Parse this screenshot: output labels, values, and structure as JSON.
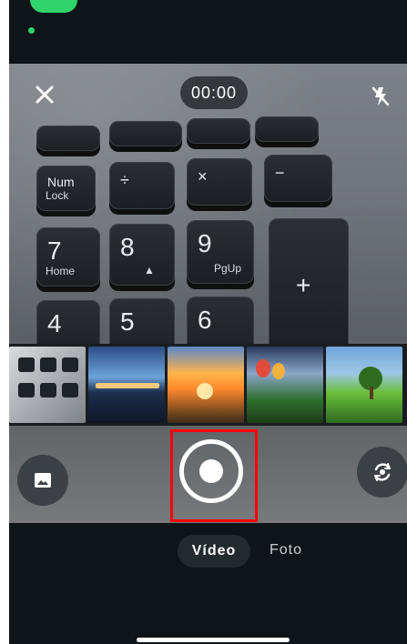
{
  "status": {
    "accent": "#2fd46a"
  },
  "camera": {
    "timer": "00:00",
    "close_icon": "close-icon",
    "flash_icon": "flash-off-icon",
    "gallery_icon": "gallery-icon",
    "flip_icon": "flip-camera-icon",
    "shutter_icon": "record-icon",
    "highlight_color": "#ff0000"
  },
  "keyboard": {
    "keys": [
      {
        "label": "Num",
        "sub": "Lock"
      },
      {
        "label": "÷",
        "sub": ""
      },
      {
        "label": "×",
        "sub": ""
      },
      {
        "label": "−",
        "sub": ""
      },
      {
        "label": "7",
        "sub": "Home"
      },
      {
        "label": "8",
        "sub": "▲"
      },
      {
        "label": "9",
        "sub": "PgUp"
      },
      {
        "label": "+",
        "sub": ""
      },
      {
        "label": "4",
        "sub": ""
      },
      {
        "label": "5",
        "sub": ""
      },
      {
        "label": "6",
        "sub": "→"
      }
    ]
  },
  "thumbnails": [
    {
      "name": "keyboard"
    },
    {
      "name": "harbor-night"
    },
    {
      "name": "sunset-beach"
    },
    {
      "name": "balloons-valley"
    },
    {
      "name": "tree-field"
    }
  ],
  "modes": {
    "video": "Vídeo",
    "photo": "Foto"
  }
}
